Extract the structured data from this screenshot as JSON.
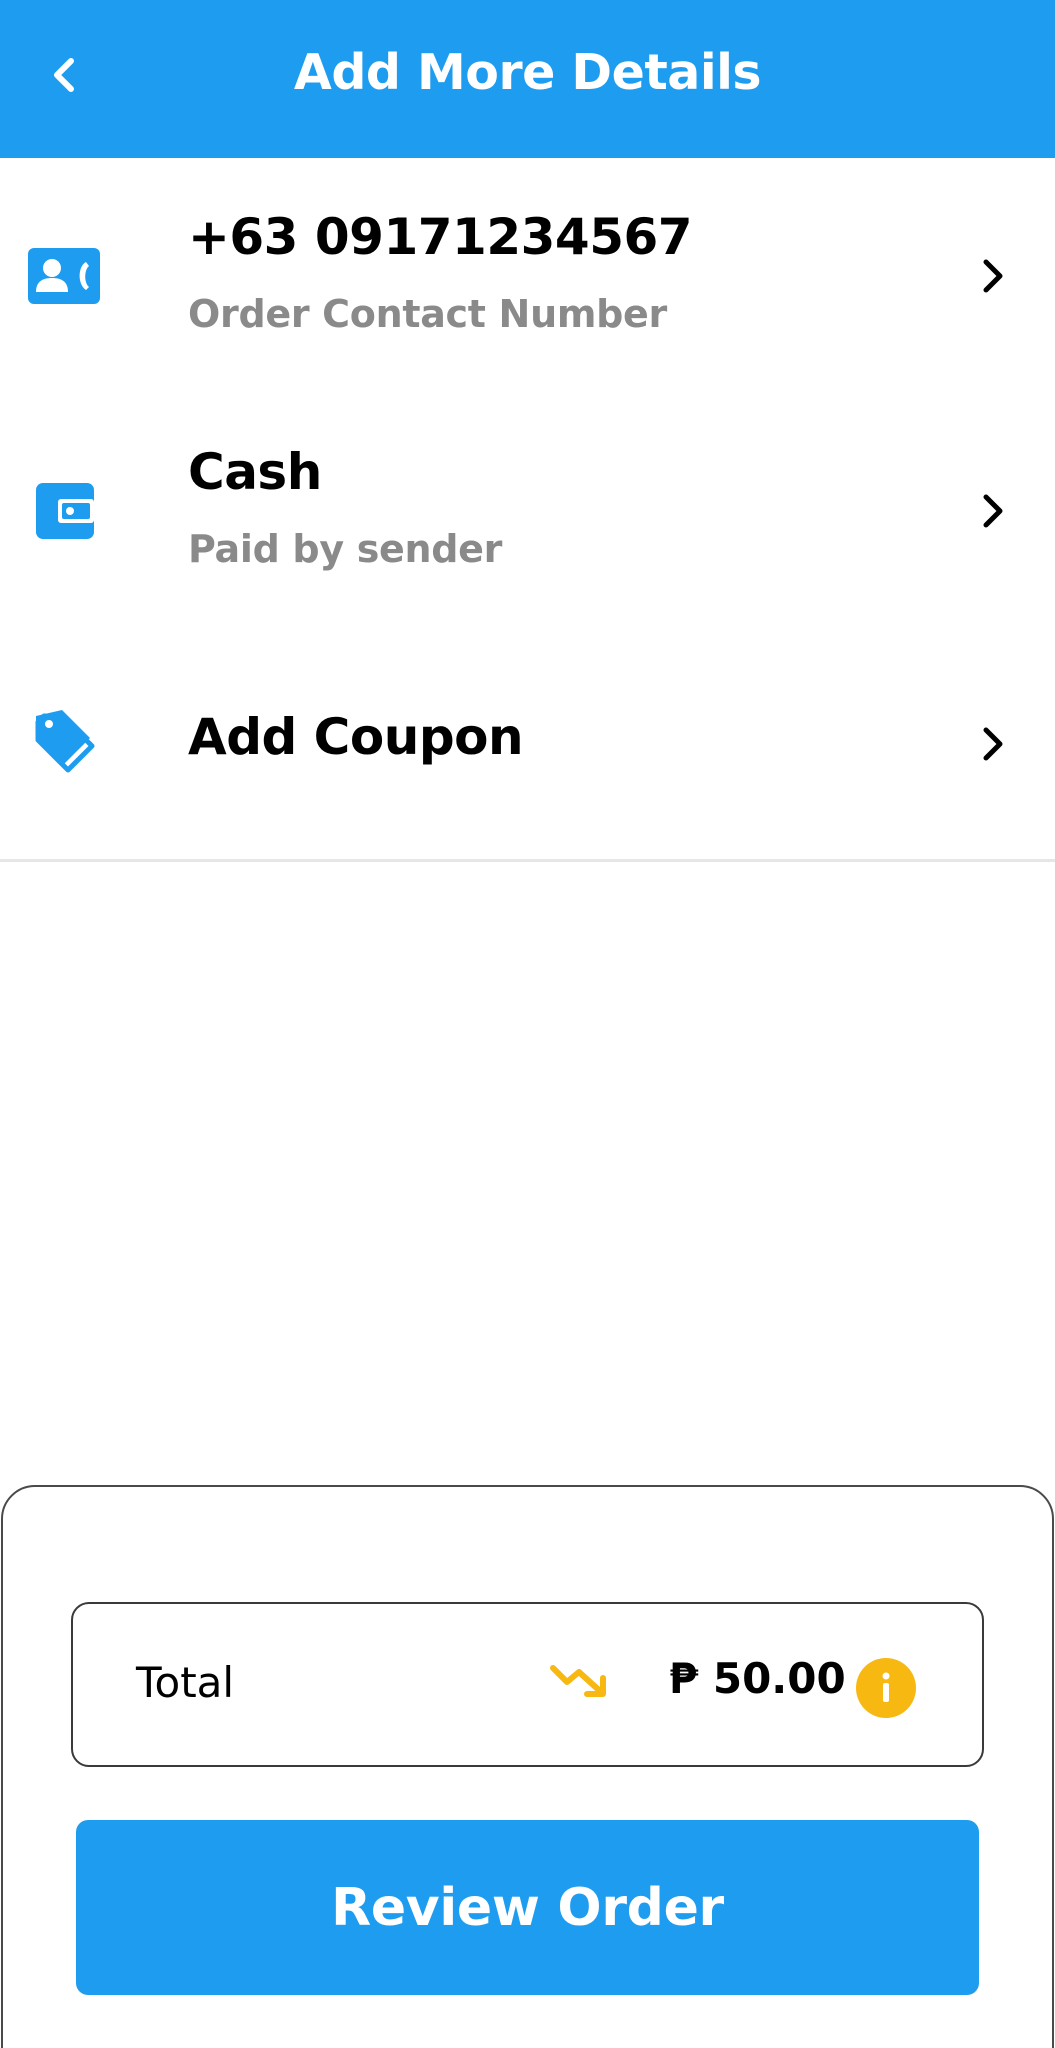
{
  "header": {
    "title": "Add More Details",
    "back_icon": "chevron-left-icon"
  },
  "details": [
    {
      "icon": "contact-card-icon",
      "title": "+63 09171234567",
      "subtitle": "Order Contact Number"
    },
    {
      "icon": "wallet-icon",
      "title": "Cash",
      "subtitle": "Paid by sender"
    },
    {
      "icon": "coupon-tag-icon",
      "title": "Add Coupon",
      "subtitle": ""
    }
  ],
  "summary": {
    "total_label": "Total",
    "total_amount": "₱ 50.00",
    "trend_icon": "trending-down-icon",
    "info_icon": "info-icon"
  },
  "actions": {
    "review_label": "Review Order"
  },
  "colors": {
    "primary": "#1e9df0",
    "accent": "#f7b812",
    "muted_text": "#8a8a8a"
  }
}
